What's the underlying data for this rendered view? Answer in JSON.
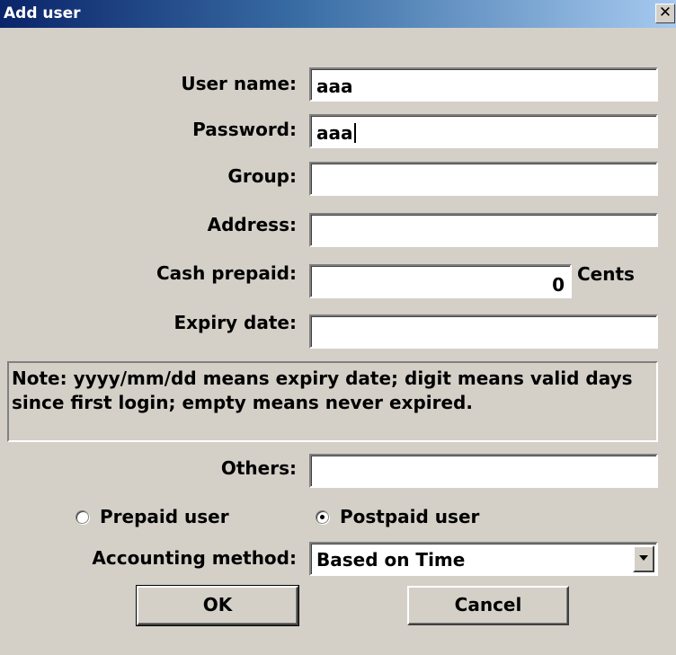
{
  "window": {
    "title": "Add user",
    "close_glyph": "✕"
  },
  "form": {
    "username": {
      "label": "User name:",
      "value": "aaa"
    },
    "password": {
      "label": "Password:",
      "value": "aaa"
    },
    "group": {
      "label": "Group:",
      "value": ""
    },
    "address": {
      "label": "Address:",
      "value": ""
    },
    "cash": {
      "label": "Cash prepaid:",
      "value": "0",
      "unit": "Cents"
    },
    "expiry": {
      "label": "Expiry date:",
      "value": ""
    },
    "note": "Note: yyyy/mm/dd means expiry date; digit means valid days since first login; empty means never expired.",
    "others": {
      "label": "Others:",
      "value": ""
    },
    "user_type": {
      "prepaid_label": "Prepaid user",
      "postpaid_label": "Postpaid user",
      "selected": "postpaid"
    },
    "accounting": {
      "label": "Accounting method:",
      "value": "Based on Time"
    }
  },
  "buttons": {
    "ok": "OK",
    "cancel": "Cancel"
  },
  "colors": {
    "title_start": "#0a246a",
    "title_end": "#a6caf0",
    "dialog_bg": "#d4d0c8"
  }
}
